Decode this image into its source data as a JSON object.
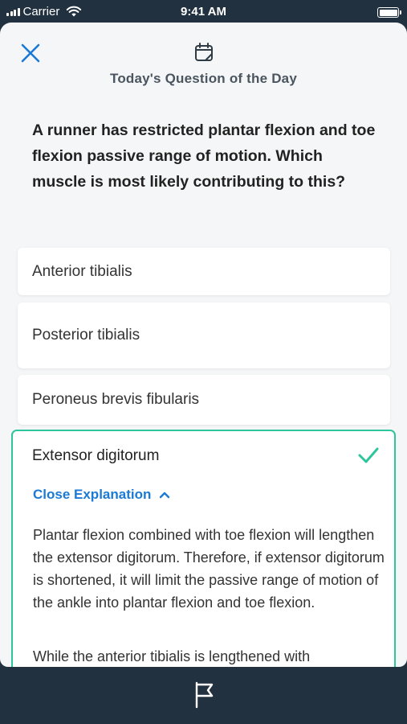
{
  "status_bar": {
    "carrier": "Carrier",
    "time": "9:41 AM"
  },
  "header": {
    "title": "Today's Question of the Day"
  },
  "question": {
    "text_before": "A runner has restricted plantar flexion and toe flexion passive range of motion. Which muscle is ",
    "emphasis": "most",
    "text_after": " likely contributing to this?"
  },
  "options": [
    {
      "label": "Anterior tibialis"
    },
    {
      "label": "Posterior tibialis"
    },
    {
      "label": "Peroneus brevis fibularis"
    }
  ],
  "answer": {
    "label": "Extensor digitorum",
    "toggle_label": "Close Explanation",
    "explanation": [
      "Plantar flexion combined with toe flexion will lengthen the extensor digitorum. Therefore, if extensor digitorum is shortened, it will limit the passive range of motion of the ankle into plantar flexion and toe flexion.",
      "While the anterior tibialis is lengthened with"
    ]
  },
  "icons": {
    "close": "close-icon",
    "calendar": "calendar-icon",
    "check": "checkmark-icon",
    "chevron": "chevron-up-icon",
    "flag": "flag-icon",
    "wifi": "wifi-icon",
    "battery": "battery-icon"
  },
  "colors": {
    "accent_blue": "#1a7ad6",
    "correct_green": "#2dc59b",
    "dark_bar": "#22313f"
  }
}
